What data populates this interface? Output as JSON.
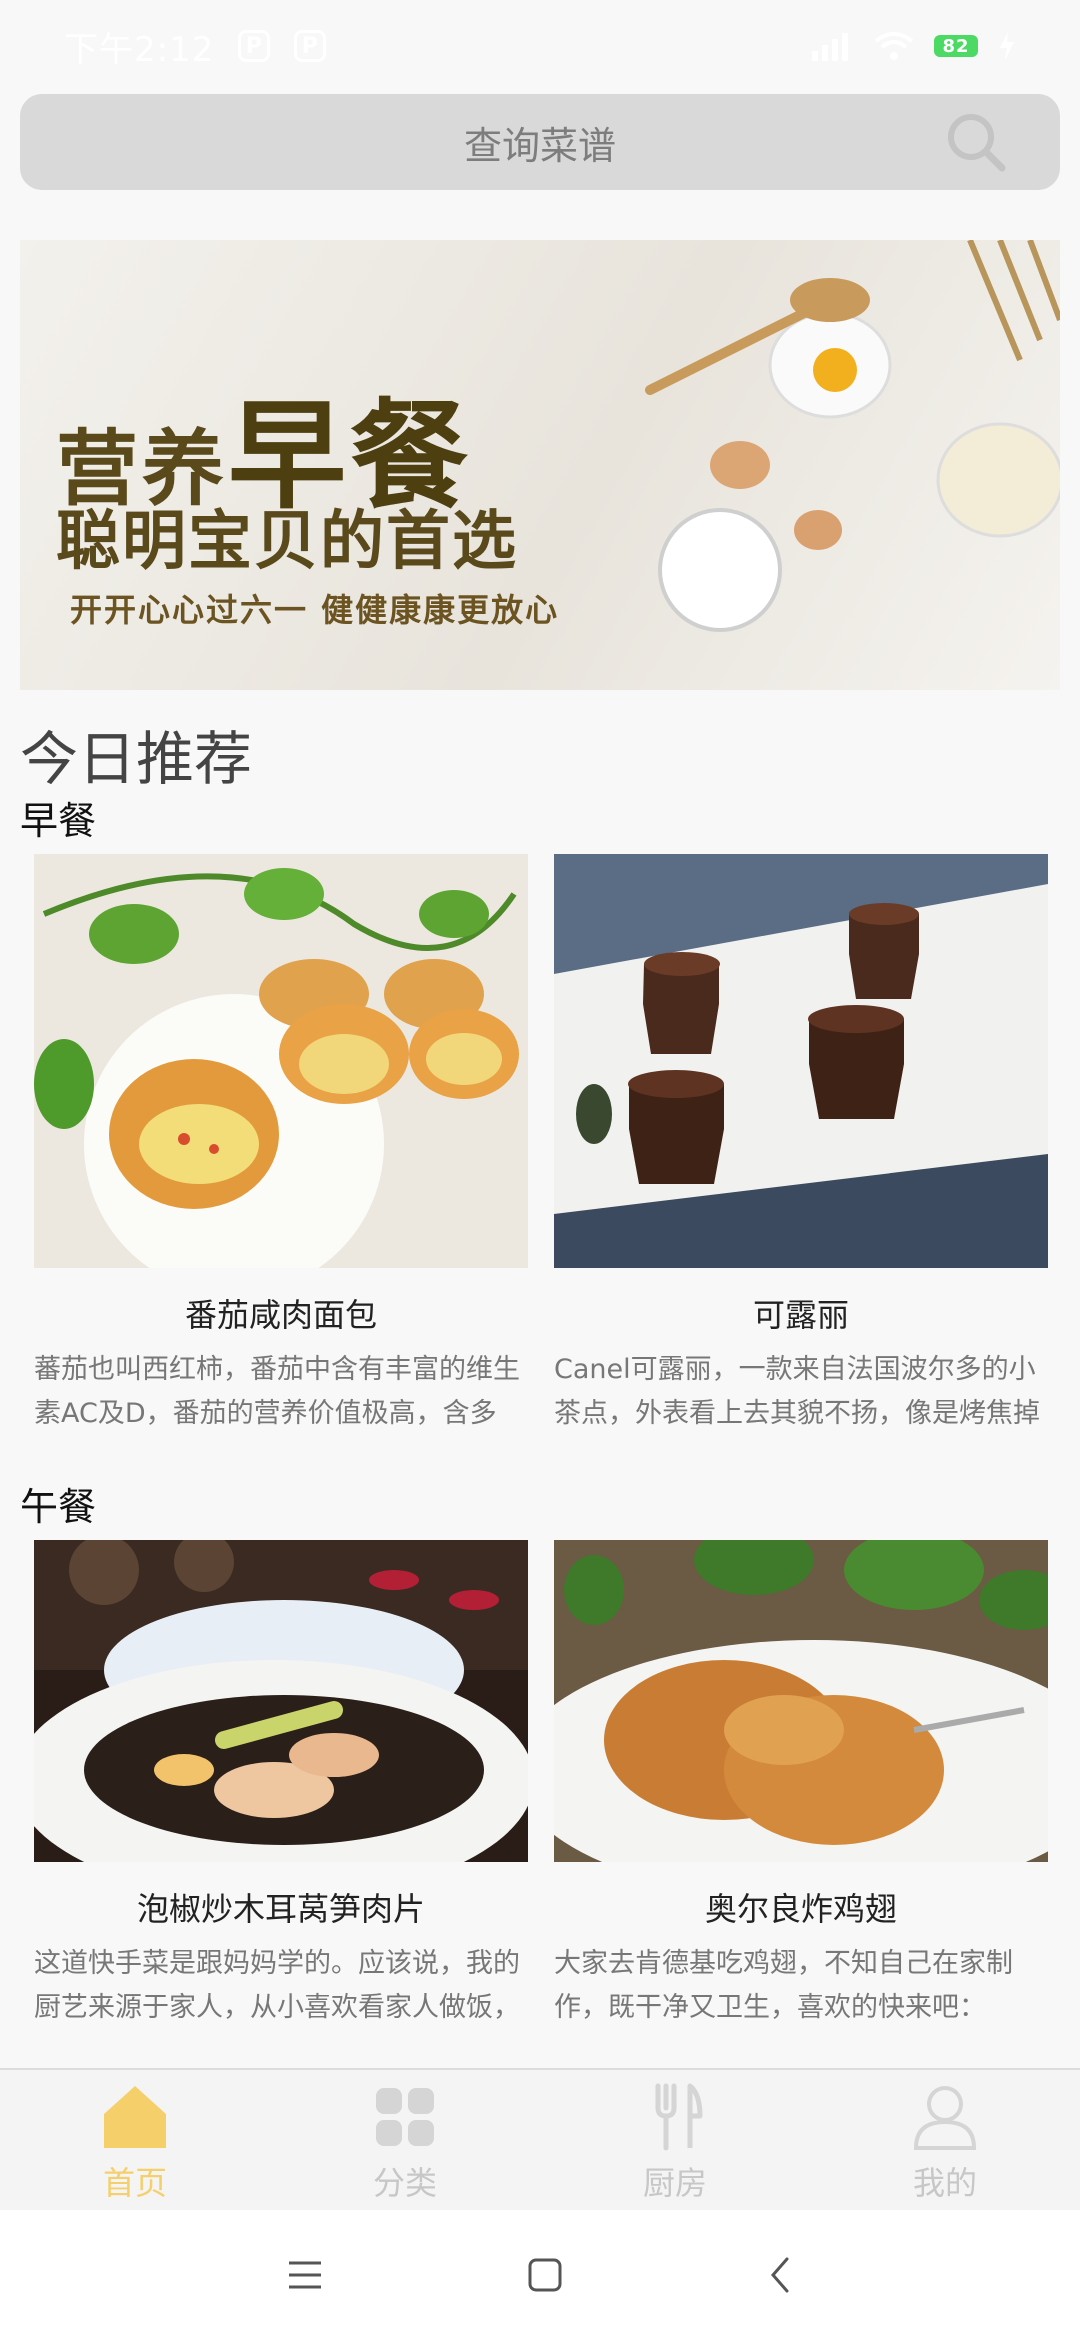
{
  "status": {
    "time": "下午2:12",
    "notif1": "P",
    "notif2": "P",
    "battery": "82"
  },
  "search": {
    "placeholder": "查询菜谱"
  },
  "banner": {
    "title_part1": "营养",
    "title_part2": "早餐",
    "title_line2": "聪明宝贝的首选",
    "subtitle": "开开心心过六一  健健康康更放心"
  },
  "section_title": "今日推荐",
  "categories": [
    {
      "title": "早餐",
      "items": [
        {
          "name": "番茄咸肉面包",
          "desc": "蕃茄也叫西红柿，番茄中含有丰富的维生素AC及D，番茄的营养价值极高，含多"
        },
        {
          "name": "可露丽",
          "desc": "Canel可露丽，一款来自法国波尔多的小茶点，外表看上去其貌不扬，像是烤焦掉"
        }
      ]
    },
    {
      "title": "午餐",
      "items": [
        {
          "name": "泡椒炒木耳莴笋肉片",
          "desc": "这道快手菜是跟妈妈学的。应该说，我的厨艺来源于家人，从小喜欢看家人做饭，"
        },
        {
          "name": "奥尔良炸鸡翅",
          "desc": "大家去肯德基吃鸡翅，不知自己在家制作，既干净又卫生，喜欢的快来吧："
        }
      ]
    }
  ],
  "tabs": [
    {
      "label": "首页",
      "active": true
    },
    {
      "label": "分类",
      "active": false
    },
    {
      "label": "厨房",
      "active": false
    },
    {
      "label": "我的",
      "active": false
    }
  ],
  "colors": {
    "accent": "#f5cf6a",
    "inactive": "#c7c7c7"
  }
}
